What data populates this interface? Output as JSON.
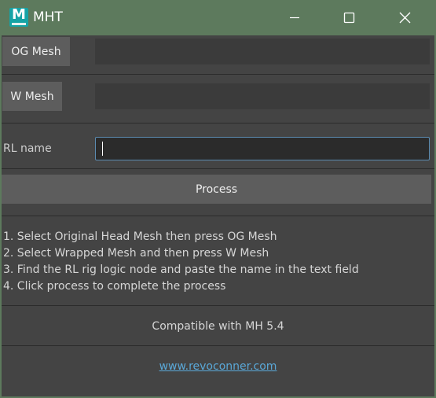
{
  "window": {
    "title": "MHT",
    "icon": "maya-m-icon",
    "accent": "#5d7a5d"
  },
  "buttons": {
    "og_mesh": "OG Mesh",
    "w_mesh": "W Mesh",
    "process": "Process"
  },
  "fields": {
    "og_mesh_value": "",
    "w_mesh_value": "",
    "rl_name_label": "RL name",
    "rl_name_value": ""
  },
  "instructions": [
    "1. Select Original Head Mesh then press OG Mesh",
    "2. Select Wrapped Mesh and then press W Mesh",
    "3. Find the RL rig logic node and paste the name in the text field",
    "4. Click process to complete the process"
  ],
  "compat": "Compatible with MH 5.4",
  "link": "www.revoconner.com",
  "colors": {
    "titlebar": "#5d7a5d",
    "panel": "#444444",
    "button": "#5d5d5d",
    "input_focus": "#5b8bb0",
    "link": "#5aa8d8"
  }
}
